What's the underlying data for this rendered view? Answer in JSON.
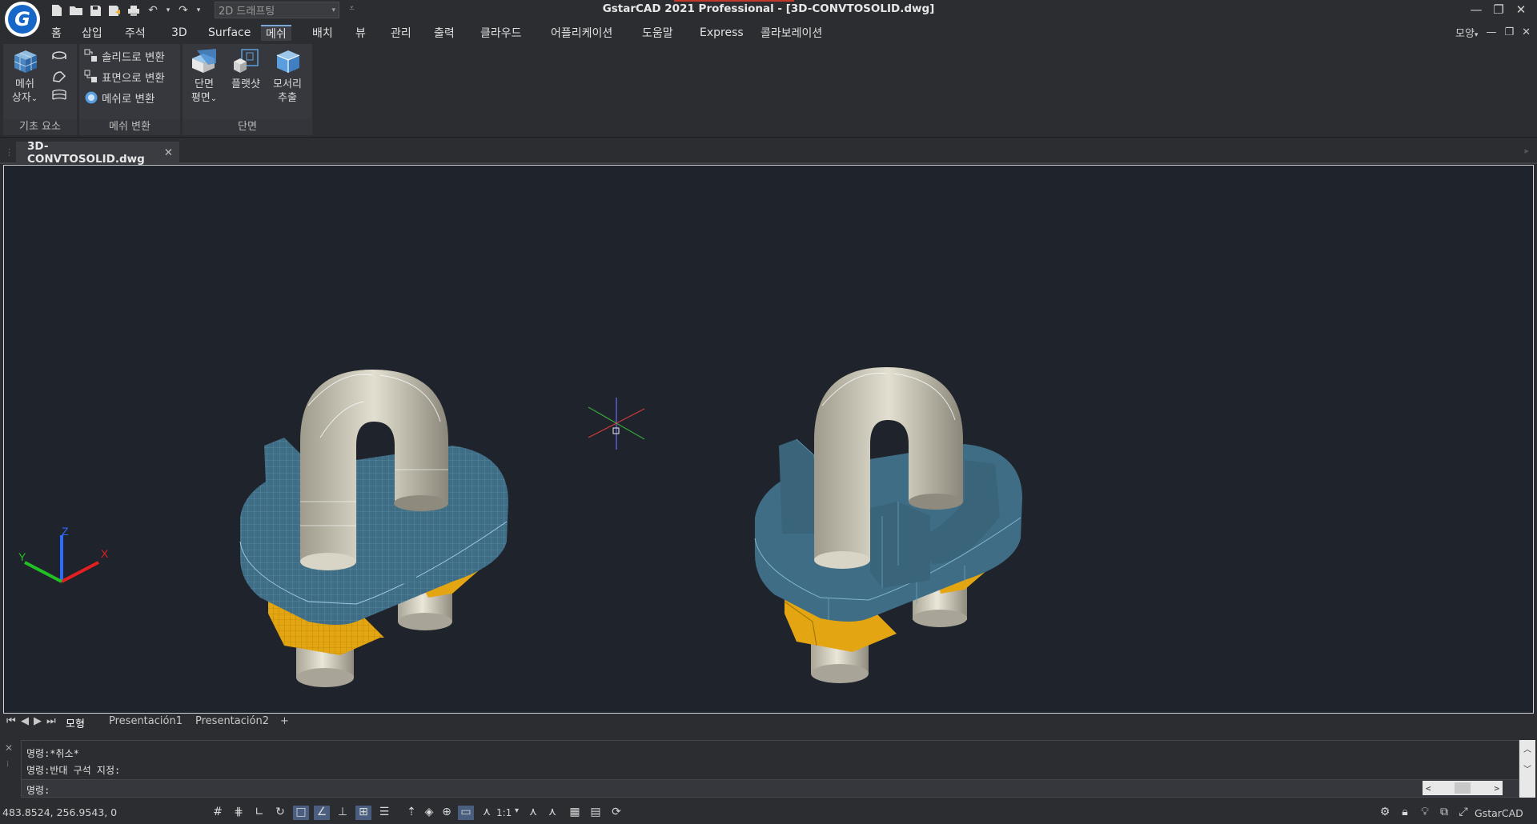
{
  "titlebar": {
    "title": "GstarCAD 2021 Professional - [3D-CONVTOSOLID.dwg]",
    "workspace": "2D 드래프팅",
    "qat_icons": [
      "new-file-icon",
      "open-folder-icon",
      "save-icon",
      "save-as-icon",
      "print-icon",
      "undo-icon",
      "redo-icon"
    ]
  },
  "menu": {
    "items": [
      "홈",
      "삽입",
      "주석",
      "3D",
      "Surface",
      "메쉬",
      "배치",
      "뷰",
      "관리",
      "출력",
      "클라우드",
      "어플리케이션",
      "도움말",
      "Express",
      "콜라보레이션"
    ],
    "active": "메쉬",
    "right_label": "모양"
  },
  "ribbon": {
    "basic": {
      "label": "기초 요소",
      "mesh_box_line1": "메쉬",
      "mesh_box_line2": "상자"
    },
    "convert": {
      "label": "메쉬 변환",
      "to_solid": "솔리드로 변환",
      "to_surface": "표면으로 변환",
      "to_mesh": "메쉬로 변환"
    },
    "section": {
      "label": "단면",
      "section_plane_line1": "단면",
      "section_plane_line2": "평면",
      "flatshot": "플랫샷",
      "extract_edges_line1": "모서리",
      "extract_edges_line2": "추출"
    }
  },
  "document": {
    "tab": "3D-CONVTOSOLID.dwg"
  },
  "layouts": {
    "tabs": [
      "모형",
      "Presentación1",
      "Presentación2"
    ],
    "add": "+"
  },
  "command": {
    "history": [
      "명령:*취소*",
      "명령:반대 구석 지정:"
    ],
    "prompt": "명령:"
  },
  "status": {
    "coords": "483.8524, 256.9543, 0",
    "scale": "1:1",
    "app": "GstarCAD"
  },
  "colors": {
    "mesh_blue": "#3f6d85",
    "bolt": "#cfcab8",
    "nut": "#e3a612",
    "canvas": "#1f232c"
  }
}
